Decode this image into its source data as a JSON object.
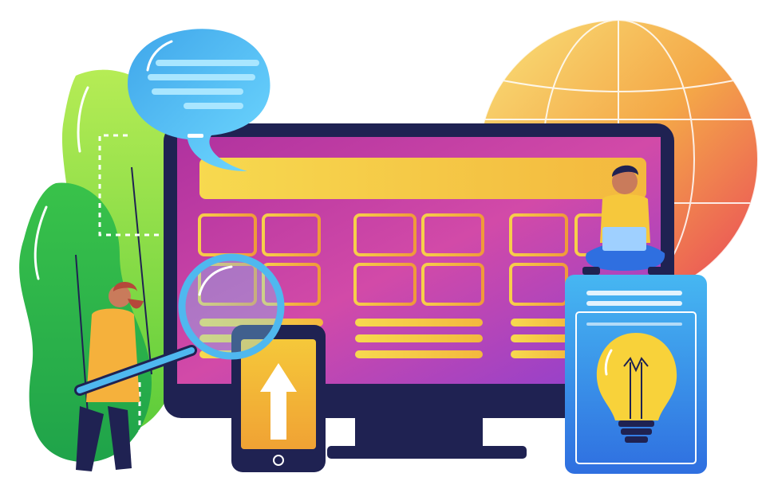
{
  "illustration": {
    "subject": "",
    "colors": {
      "navy": "#1f2252",
      "screen_pink": "#c53bb0",
      "screen_purple": "#8b3fd0",
      "yellow": "#f4d24a",
      "orange": "#f0a03a",
      "sky_blue": "#4fb8ef",
      "light_blue": "#7fd4ff",
      "green_dark": "#2fb84a",
      "green_light": "#8fdc3a",
      "globe_yellow": "#f6d36b",
      "globe_red": "#ec5a57",
      "bulb_yellow": "#f8d23a",
      "skin": "#c97b5b",
      "beard": "#b5483a",
      "white": "#ffffff"
    },
    "icons": [
      "speech-bubble-icon",
      "globe-icon",
      "magnifier-icon",
      "upload-arrow-icon",
      "lightbulb-icon"
    ]
  }
}
